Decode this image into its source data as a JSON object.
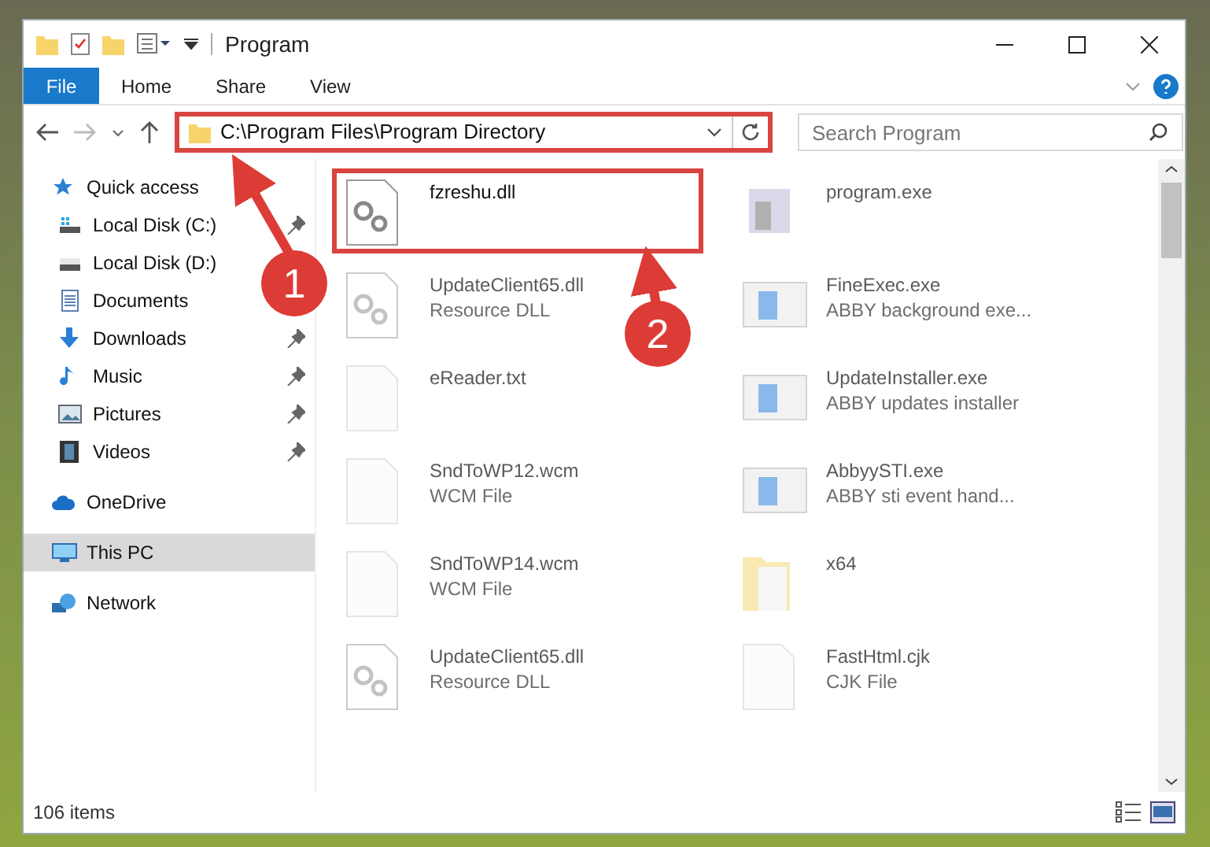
{
  "window": {
    "title": "Program"
  },
  "ribbon_tabs": [
    {
      "label": "File",
      "selected": true
    },
    {
      "label": "Home",
      "selected": false
    },
    {
      "label": "Share",
      "selected": false
    },
    {
      "label": "View",
      "selected": false
    }
  ],
  "address": {
    "path": "C:\\Program Files\\Program Directory",
    "highlighted": true
  },
  "search": {
    "placeholder": "Search Program"
  },
  "navigation": [
    {
      "label": "Quick access",
      "kind": "star",
      "selected": false,
      "children": [
        {
          "label": "Local Disk (C:)",
          "kind": "drive-c",
          "pinned": true,
          "selected": false
        },
        {
          "label": "Local Disk (D:)",
          "kind": "drive",
          "pinned": false,
          "selected": false
        },
        {
          "label": "Documents",
          "kind": "documents",
          "pinned": false,
          "selected": false
        },
        {
          "label": "Downloads",
          "kind": "downloads",
          "pinned": true,
          "selected": false
        },
        {
          "label": "Music",
          "kind": "music",
          "pinned": true,
          "selected": false
        },
        {
          "label": "Pictures",
          "kind": "pictures",
          "pinned": true,
          "selected": false
        },
        {
          "label": "Videos",
          "kind": "videos",
          "pinned": true,
          "selected": false
        }
      ]
    },
    {
      "label": "OneDrive",
      "kind": "cloud",
      "selected": false
    },
    {
      "label": "This PC",
      "kind": "pc",
      "selected": true
    },
    {
      "label": "Network",
      "kind": "network",
      "selected": false
    }
  ],
  "files": [
    {
      "name": "fzreshu.dll",
      "kind": "dll",
      "highlighted": true,
      "blurred": false
    },
    {
      "name": "program.exe",
      "kind": "exe",
      "highlighted": false,
      "blurred": true
    },
    {
      "name": "UpdateClient65.dll",
      "type": "Resource DLL",
      "kind": "dll",
      "highlighted": false,
      "blurred": true
    },
    {
      "name": "FineExec.exe",
      "type": "ABBY background exe...",
      "kind": "app",
      "highlighted": false,
      "blurred": true
    },
    {
      "name": "eReader.txt",
      "kind": "text",
      "highlighted": false,
      "blurred": true
    },
    {
      "name": "UpdateInstaller.exe",
      "type": "ABBY updates installer",
      "kind": "app",
      "highlighted": false,
      "blurred": true
    },
    {
      "name": "SndToWP12.wcm",
      "type": "WCM File",
      "kind": "text",
      "highlighted": false,
      "blurred": true
    },
    {
      "name": "AbbyySTI.exe",
      "type": "ABBY sti event hand...",
      "kind": "app",
      "highlighted": false,
      "blurred": true
    },
    {
      "name": "SndToWP14.wcm",
      "type": "WCM File",
      "kind": "text",
      "highlighted": false,
      "blurred": true
    },
    {
      "name": "x64",
      "kind": "folder",
      "highlighted": false,
      "blurred": true
    },
    {
      "name": "UpdateClient65.dll",
      "type": "Resource DLL",
      "kind": "dll",
      "highlighted": false,
      "blurred": true
    },
    {
      "name": "FastHtml.cjk",
      "type": "CJK File",
      "kind": "text",
      "highlighted": false,
      "blurred": true
    }
  ],
  "steps": [
    {
      "label": "1"
    },
    {
      "label": "2"
    }
  ],
  "status_bar": {
    "count": "106 items"
  }
}
